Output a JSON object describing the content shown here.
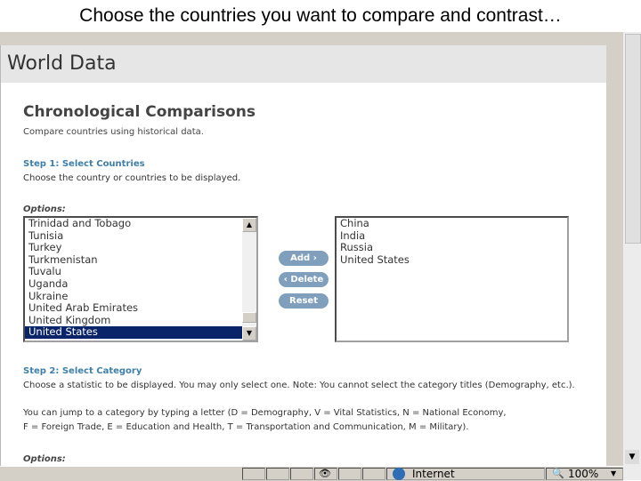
{
  "slide_title": "Choose the countries you want to compare and contrast…",
  "site_title": "World Data",
  "page": {
    "heading": "Chronological Comparisons",
    "subheading": "Compare countries using historical data.",
    "step1_title": "Step 1: Select Countries",
    "step1_desc": "Choose the country or countries to be displayed.",
    "options_label": "Options:",
    "step2_title": "Step 2: Select Category",
    "step2_desc": "Choose a statistic to be displayed. You may only select one. Note: You cannot select the category titles (Demography, etc.).",
    "jump_line1": "You can jump to a category by typing a letter (D = Demography, V = Vital Statistics, N = National Economy,",
    "jump_line2": "F = Foreign Trade, E = Education and Health, T = Transportation and Communication, M = Military).",
    "options_label2": "Options:"
  },
  "options_list": [
    "Trinidad and Tobago",
    "Tunisia",
    "Turkey",
    "Turkmenistan",
    "Tuvalu",
    "Uganda",
    "Ukraine",
    "United Arab Emirates",
    "United Kingdom",
    "United States"
  ],
  "selected_option": "United States",
  "selected_list": [
    "China",
    "India",
    "Russia",
    "United States"
  ],
  "buttons": {
    "add": "Add ›",
    "delete": "‹ Delete",
    "reset": "Reset"
  },
  "status_bar": {
    "zone": "Internet",
    "zoom": "100%",
    "dropdown_glyph": "▼"
  },
  "icons": {
    "globe": "globe-icon",
    "zoom": "magnifier-icon",
    "privacy": "privacy-icon"
  }
}
